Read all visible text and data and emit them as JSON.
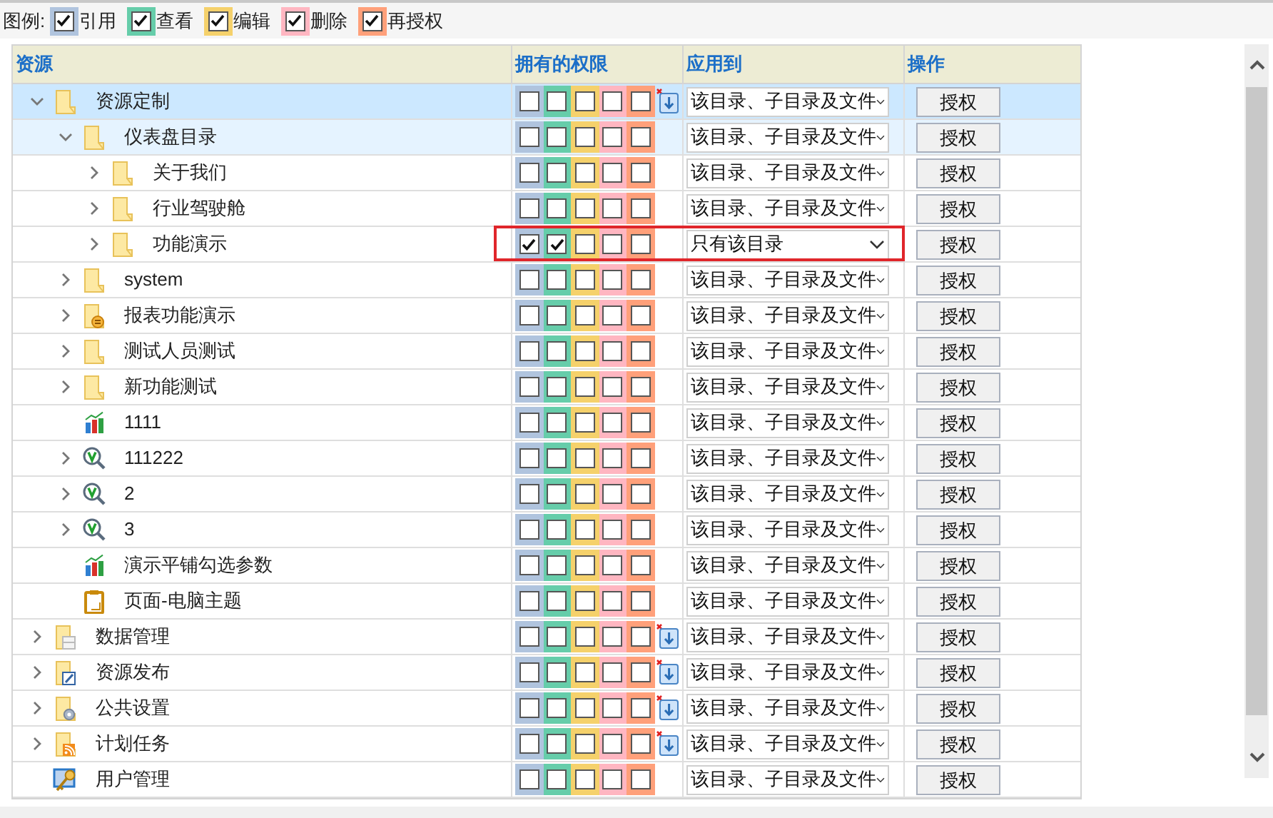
{
  "legend": {
    "label": "图例:",
    "items": [
      {
        "label": "引用",
        "color": "#b0c4de",
        "checked": true
      },
      {
        "label": "查看",
        "color": "#66cdaa",
        "checked": true
      },
      {
        "label": "编辑",
        "color": "#f5d16b",
        "checked": true
      },
      {
        "label": "删除",
        "color": "#ffb6c1",
        "checked": true
      },
      {
        "label": "再授权",
        "color": "#ffa07a",
        "checked": true
      }
    ]
  },
  "table": {
    "columns": [
      "资源",
      "拥有的权限",
      "应用到",
      "操作"
    ],
    "rows": [
      {
        "name": "资源定制",
        "kind": "folder",
        "expandable": true,
        "expanded": true,
        "selected": true,
        "hovered": false,
        "perms": [
          false,
          false,
          false,
          false,
          false
        ],
        "reset_icon": true,
        "flagged": false,
        "scope": "该目录、子目录及文件",
        "action": "授权",
        "children": [
          {
            "name": "仪表盘目录",
            "kind": "folder",
            "expandable": true,
            "expanded": true,
            "selected": false,
            "hovered": true,
            "perms": [
              false,
              false,
              false,
              false,
              false
            ],
            "reset_icon": false,
            "flagged": false,
            "scope": "该目录、子目录及文件",
            "action": "授权",
            "children": [
              {
                "name": "关于我们",
                "kind": "folder",
                "expandable": true,
                "expanded": false,
                "selected": false,
                "hovered": false,
                "perms": [
                  false,
                  false,
                  false,
                  false,
                  false
                ],
                "reset_icon": false,
                "flagged": false,
                "scope": "该目录、子目录及文件",
                "action": "授权"
              },
              {
                "name": "行业驾驶舱",
                "kind": "folder",
                "expandable": true,
                "expanded": false,
                "selected": false,
                "hovered": false,
                "perms": [
                  false,
                  false,
                  false,
                  false,
                  false
                ],
                "reset_icon": false,
                "flagged": false,
                "scope": "该目录、子目录及文件",
                "action": "授权"
              },
              {
                "name": "功能演示",
                "kind": "folder",
                "expandable": true,
                "expanded": false,
                "selected": false,
                "hovered": false,
                "perms": [
                  true,
                  true,
                  false,
                  false,
                  false
                ],
                "reset_icon": false,
                "flagged": true,
                "scope": "只有该目录",
                "action": "授权"
              }
            ]
          },
          {
            "name": "system",
            "kind": "folder",
            "expandable": true,
            "expanded": false,
            "selected": false,
            "hovered": false,
            "perms": [
              false,
              false,
              false,
              false,
              false
            ],
            "reset_icon": false,
            "flagged": false,
            "scope": "该目录、子目录及文件",
            "action": "授权"
          },
          {
            "name": "报表功能演示",
            "kind": "report-folder",
            "expandable": true,
            "expanded": false,
            "selected": false,
            "hovered": false,
            "perms": [
              false,
              false,
              false,
              false,
              false
            ],
            "reset_icon": false,
            "flagged": false,
            "scope": "该目录、子目录及文件",
            "action": "授权"
          },
          {
            "name": "测试人员测试",
            "kind": "folder",
            "expandable": true,
            "expanded": false,
            "selected": false,
            "hovered": false,
            "perms": [
              false,
              false,
              false,
              false,
              false
            ],
            "reset_icon": false,
            "flagged": false,
            "scope": "该目录、子目录及文件",
            "action": "授权"
          },
          {
            "name": "新功能测试",
            "kind": "folder",
            "expandable": true,
            "expanded": false,
            "selected": false,
            "hovered": false,
            "perms": [
              false,
              false,
              false,
              false,
              false
            ],
            "reset_icon": false,
            "flagged": false,
            "scope": "该目录、子目录及文件",
            "action": "授权"
          },
          {
            "name": "1111",
            "kind": "chart",
            "expandable": false,
            "selected": false,
            "hovered": false,
            "perms": [
              false,
              false,
              false,
              false,
              false
            ],
            "reset_icon": false,
            "flagged": false,
            "scope": "该目录、子目录及文件",
            "action": "授权"
          },
          {
            "name": "111222",
            "kind": "viewer",
            "expandable": true,
            "expanded": false,
            "selected": false,
            "hovered": false,
            "perms": [
              false,
              false,
              false,
              false,
              false
            ],
            "reset_icon": false,
            "flagged": false,
            "scope": "该目录、子目录及文件",
            "action": "授权"
          },
          {
            "name": "2",
            "kind": "viewer",
            "expandable": true,
            "expanded": false,
            "selected": false,
            "hovered": false,
            "perms": [
              false,
              false,
              false,
              false,
              false
            ],
            "reset_icon": false,
            "flagged": false,
            "scope": "该目录、子目录及文件",
            "action": "授权"
          },
          {
            "name": "3",
            "kind": "viewer",
            "expandable": true,
            "expanded": false,
            "selected": false,
            "hovered": false,
            "perms": [
              false,
              false,
              false,
              false,
              false
            ],
            "reset_icon": false,
            "flagged": false,
            "scope": "该目录、子目录及文件",
            "action": "授权"
          },
          {
            "name": "演示平铺勾选参数",
            "kind": "chart",
            "expandable": false,
            "selected": false,
            "hovered": false,
            "perms": [
              false,
              false,
              false,
              false,
              false
            ],
            "reset_icon": false,
            "flagged": false,
            "scope": "该目录、子目录及文件",
            "action": "授权"
          },
          {
            "name": "页面-电脑主题",
            "kind": "page",
            "expandable": false,
            "selected": false,
            "hovered": false,
            "perms": [
              false,
              false,
              false,
              false,
              false
            ],
            "reset_icon": false,
            "flagged": false,
            "scope": "该目录、子目录及文件",
            "action": "授权"
          }
        ]
      },
      {
        "name": "数据管理",
        "kind": "data-folder",
        "expandable": true,
        "expanded": false,
        "selected": false,
        "hovered": false,
        "perms": [
          false,
          false,
          false,
          false,
          false
        ],
        "reset_icon": true,
        "flagged": false,
        "scope": "该目录、子目录及文件",
        "action": "授权"
      },
      {
        "name": "资源发布",
        "kind": "publish-folder",
        "expandable": true,
        "expanded": false,
        "selected": false,
        "hovered": false,
        "perms": [
          false,
          false,
          false,
          false,
          false
        ],
        "reset_icon": true,
        "flagged": false,
        "scope": "该目录、子目录及文件",
        "action": "授权"
      },
      {
        "name": "公共设置",
        "kind": "settings-folder",
        "expandable": true,
        "expanded": false,
        "selected": false,
        "hovered": false,
        "perms": [
          false,
          false,
          false,
          false,
          false
        ],
        "reset_icon": true,
        "flagged": false,
        "scope": "该目录、子目录及文件",
        "action": "授权"
      },
      {
        "name": "计划任务",
        "kind": "feed-folder",
        "expandable": true,
        "expanded": false,
        "selected": false,
        "hovered": false,
        "perms": [
          false,
          false,
          false,
          false,
          false
        ],
        "reset_icon": true,
        "flagged": false,
        "scope": "该目录、子目录及文件",
        "action": "授权"
      },
      {
        "name": "用户管理",
        "kind": "user-key",
        "expandable": false,
        "selected": false,
        "hovered": false,
        "perms": [
          false,
          false,
          false,
          false,
          false
        ],
        "reset_icon": false,
        "flagged": false,
        "scope": "该目录、子目录及文件",
        "action": "授权"
      }
    ]
  }
}
